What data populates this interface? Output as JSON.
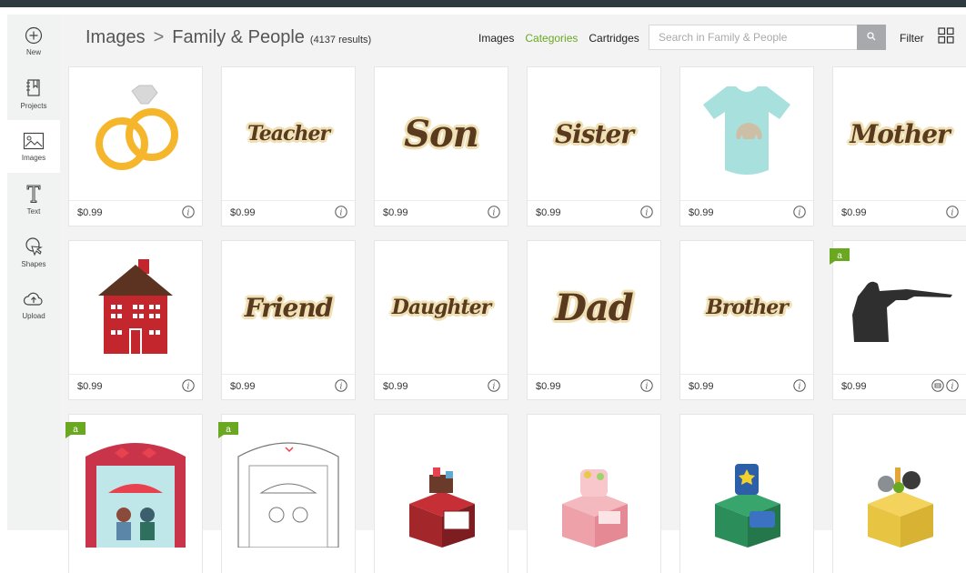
{
  "sidebar": {
    "items": [
      {
        "label": "New",
        "icon": "plus-circle-icon"
      },
      {
        "label": "Projects",
        "icon": "projects-icon"
      },
      {
        "label": "Images",
        "icon": "images-icon"
      },
      {
        "label": "Text",
        "icon": "text-icon"
      },
      {
        "label": "Shapes",
        "icon": "shapes-icon"
      },
      {
        "label": "Upload",
        "icon": "upload-cloud-icon"
      }
    ],
    "active": "Images"
  },
  "header": {
    "breadcrumb_root": "Images",
    "breadcrumb_separator": ">",
    "breadcrumb_current": "Family & People",
    "result_count": "(4137 results)",
    "nav": {
      "images": "Images",
      "categories": "Categories",
      "cartridges": "Cartridges"
    },
    "active_nav": "Categories",
    "search_placeholder": "Search in Family & People",
    "filter_label": "Filter"
  },
  "colors": {
    "accent_green": "#6aa821",
    "topbar": "#2e3a40",
    "sidebar_bg": "#f1f2f2",
    "content_bg": "#f3f3f3"
  },
  "cards": [
    {
      "art": "rings",
      "price": "$0.99",
      "badge": false
    },
    {
      "art": "word",
      "word": "Teacher",
      "price": "$0.99",
      "badge": false
    },
    {
      "art": "word",
      "word": "Son",
      "price": "$0.99",
      "badge": false
    },
    {
      "art": "word",
      "word": "Sister",
      "price": "$0.99",
      "badge": false
    },
    {
      "art": "onesie",
      "price": "$0.99",
      "badge": false
    },
    {
      "art": "word",
      "word": "Mother",
      "price": "$0.99",
      "badge": false
    },
    {
      "art": "house",
      "price": "$0.99",
      "badge": false
    },
    {
      "art": "word",
      "word": "Friend",
      "price": "$0.99",
      "badge": false
    },
    {
      "art": "word",
      "word": "Daughter",
      "price": "$0.99",
      "badge": false
    },
    {
      "art": "word",
      "word": "Dad",
      "price": "$0.99",
      "badge": false
    },
    {
      "art": "word",
      "word": "Brother",
      "price": "$0.99",
      "badge": false
    },
    {
      "art": "shooter",
      "price": "$0.99",
      "badge": true,
      "printable": true
    },
    {
      "art": "love-box-color",
      "price": "",
      "badge": true
    },
    {
      "art": "love-box-outline",
      "price": "",
      "badge": true
    },
    {
      "art": "pop-box-red",
      "price": "",
      "badge": false
    },
    {
      "art": "pop-box-pink",
      "price": "",
      "badge": false
    },
    {
      "art": "pop-box-boy",
      "price": "",
      "badge": false
    },
    {
      "art": "pop-box-yellow",
      "price": "",
      "badge": false
    }
  ]
}
